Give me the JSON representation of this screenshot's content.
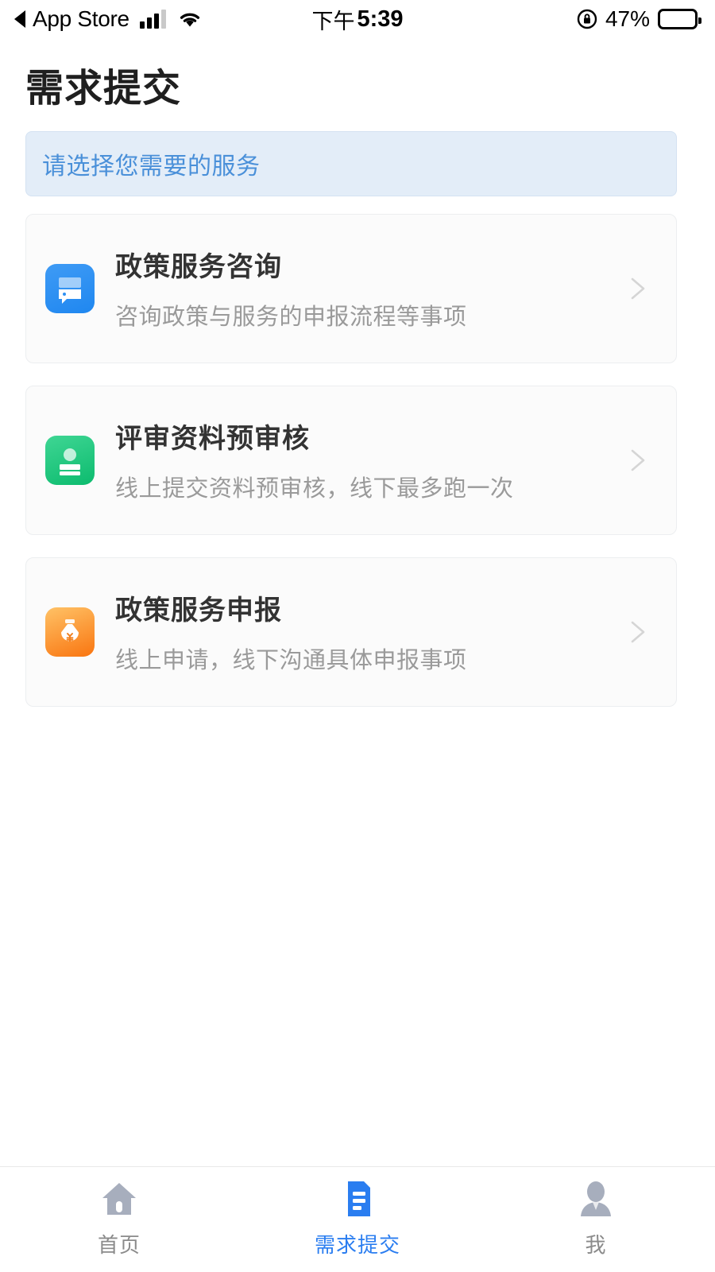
{
  "status_bar": {
    "back_label": "App Store",
    "back_icon": "back-triangle-icon",
    "signal_icon": "cellular-signal-icon",
    "wifi_icon": "wifi-icon",
    "time_period": "下午",
    "time": "5:39",
    "rotation_lock_icon": "rotation-lock-icon",
    "battery_percent": "47%",
    "battery_level": 47,
    "battery_icon": "battery-icon"
  },
  "header": {
    "title": "需求提交"
  },
  "hint": {
    "text": "请选择您需要的服务",
    "bg_color": "#e3edf8",
    "text_color": "#4a90d9"
  },
  "services": [
    {
      "title": "政策服务咨询",
      "subtitle": "咨询政策与服务的申报流程等事项",
      "icon": "chat-bubble-icon",
      "icon_color": "#1f87f0",
      "chevron": "chevron-right-icon"
    },
    {
      "title": "评审资料预审核",
      "subtitle": "线上提交资料预审核，线下最多跑一次",
      "icon": "id-card-icon",
      "icon_color": "#0cbb6e",
      "chevron": "chevron-right-icon"
    },
    {
      "title": "政策服务申报",
      "subtitle": "线上申请，线下沟通具体申报事项",
      "icon": "money-bag-icon",
      "icon_color": "#f97510",
      "chevron": "chevron-right-icon"
    }
  ],
  "tabbar": {
    "active_color": "#2a7df0",
    "inactive_color": "#8b8b8b",
    "items": [
      {
        "label": "首页",
        "icon": "home-icon",
        "active": false
      },
      {
        "label": "需求提交",
        "icon": "document-icon",
        "active": true
      },
      {
        "label": "我",
        "icon": "person-icon",
        "active": false
      }
    ]
  }
}
